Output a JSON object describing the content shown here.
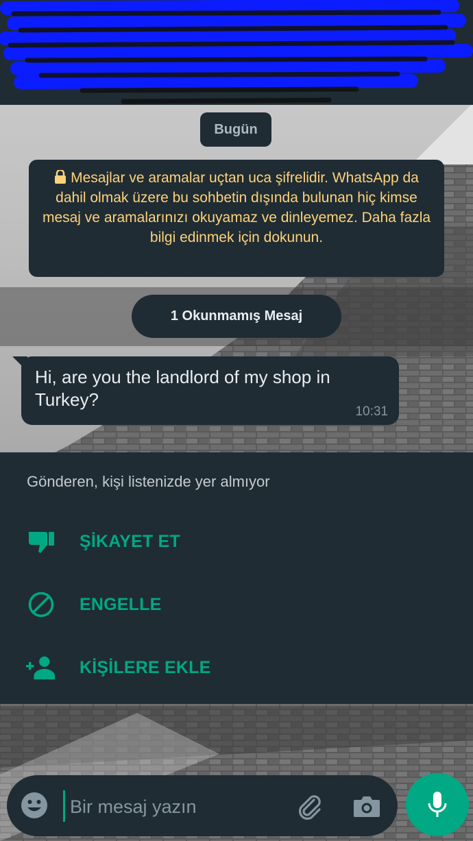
{
  "chat": {
    "date_chip": "Bugün",
    "encryption_notice": "Mesajlar ve aramalar uçtan uca şifrelidir. WhatsApp da dahil olmak üzere bu sohbetin dışında bulunan hiç kimse mesaj ve aramalarınızı okuyamaz ve dinleyemez. Daha fazla bilgi edinmek için dokunun.",
    "unread_label": "1 Okunmamış Mesaj",
    "messages": [
      {
        "text": "Hi, are you the landlord of my shop in Turkey?",
        "time": "10:31"
      }
    ]
  },
  "unknown_sender": {
    "note": "Gönderen, kişi listenizde yer almıyor",
    "actions": [
      {
        "label": "ŞİKAYET ET",
        "icon": "thumbs-down-icon"
      },
      {
        "label": "ENGELLE",
        "icon": "block-icon"
      },
      {
        "label": "KİŞİLERE EKLE",
        "icon": "add-contact-icon"
      }
    ]
  },
  "composer": {
    "placeholder": "Bir mesaj yazın",
    "icons": [
      "emoji-icon",
      "attach-icon",
      "camera-icon",
      "mic-icon"
    ]
  },
  "colors": {
    "panel": "#1f2c34",
    "accent": "#00a884",
    "notice_text": "#ffd279"
  }
}
